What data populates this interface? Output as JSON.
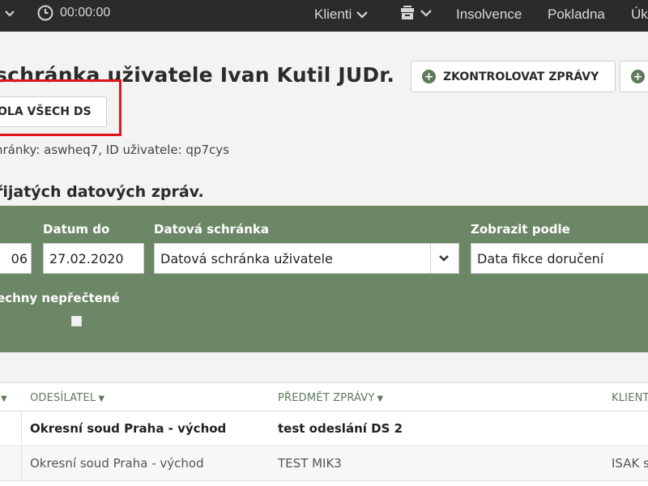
{
  "topbar": {
    "timer": "00:00:00",
    "nav": {
      "klienti": "Klienti",
      "insolvence": "Insolvence",
      "pokladna": "Pokladna",
      "ukoly": "Úk"
    }
  },
  "header": {
    "title": "schránka uživatele Ivan Kutil JUDr.",
    "btn_check": "ZKONTROLOVAT ZPRÁVY",
    "btn_all": "OLA VŠECH DS",
    "meta": "hránky: aswheq7, ID uživatele: qp7cys",
    "section_title": "řijatých datových zpráv."
  },
  "filter": {
    "date_from_value": "06",
    "date_to_label": "Datum do",
    "date_to_value": "27.02.2020",
    "box_label": "Datová schránka",
    "box_value": "Datová schránka uživatele",
    "show_by_label": "Zobrazit podle",
    "show_by_value": "Data fikce doručení",
    "unread_label": "echny nepřečtené"
  },
  "table": {
    "columns": {
      "sender": "ODESÍLATEL",
      "subject": "PŘEDMĚT ZPRÁVY",
      "client": "KLIENT"
    },
    "rows": [
      {
        "sender": "Okresní soud Praha - východ",
        "subject": "test odeslání DS 2",
        "client": ""
      },
      {
        "sender": "Okresní soud Praha - východ",
        "subject": "TEST MIK3",
        "client": "ISAK s"
      }
    ]
  }
}
